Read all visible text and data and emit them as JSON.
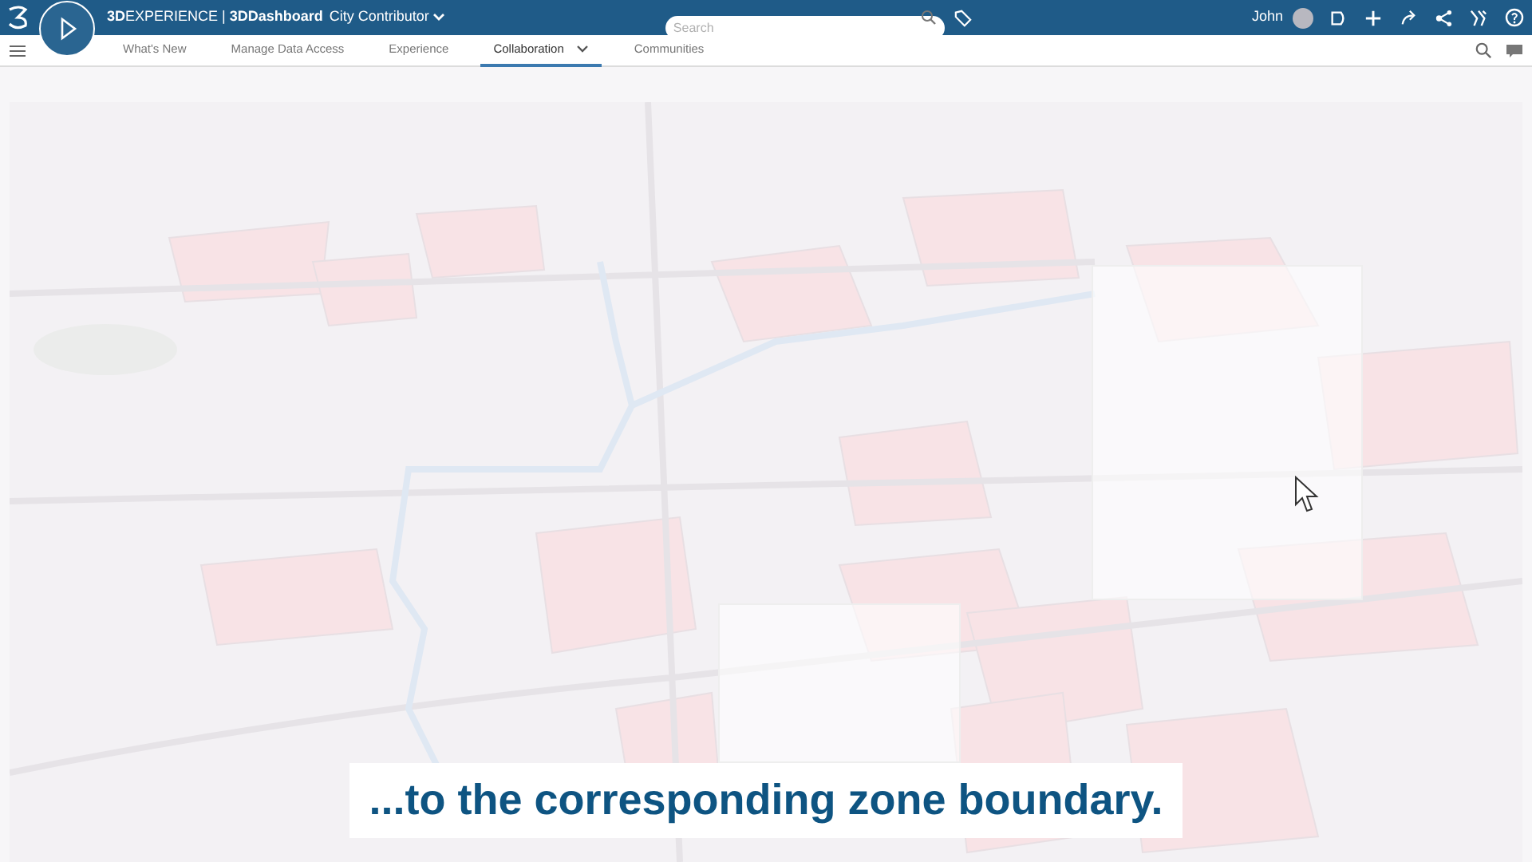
{
  "header": {
    "brand": "**3D**EXPERIENCE | **3DDashboard**",
    "role": "City Contributor",
    "search": {
      "placeholder": "Search"
    },
    "user": "John"
  },
  "tabs": [
    {
      "label": "What's New",
      "selected": false,
      "dropdown": false
    },
    {
      "label": "Manage Data Access",
      "selected": false,
      "dropdown": false
    },
    {
      "label": "Experience",
      "selected": false,
      "dropdown": false
    },
    {
      "label": "Collaboration",
      "selected": true,
      "dropdown": true
    },
    {
      "label": "Communities",
      "selected": false,
      "dropdown": false
    }
  ],
  "caption": "...to the corresponding zone boundary."
}
